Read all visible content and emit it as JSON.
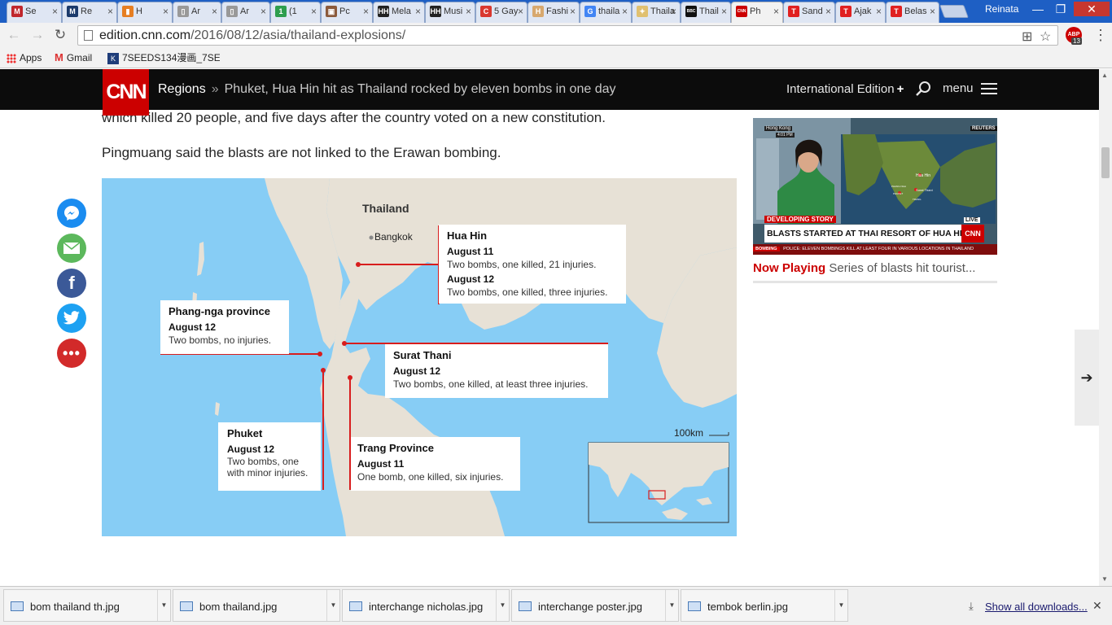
{
  "browser": {
    "tabs": [
      {
        "title": "Se",
        "color": "#c0272d",
        "glyph": "M"
      },
      {
        "title": "Re",
        "color": "#1b3a6b",
        "glyph": "M"
      },
      {
        "title": "H",
        "color": "#e67e22",
        "glyph": "▮"
      },
      {
        "title": "Ar",
        "color": "#999999",
        "glyph": "▯"
      },
      {
        "title": "Ar",
        "color": "#999999",
        "glyph": "▯"
      },
      {
        "title": "(1",
        "color": "#2e9e4e",
        "glyph": "1"
      },
      {
        "title": "Pc",
        "color": "#8b5a3c",
        "glyph": "▣"
      },
      {
        "title": "Mela",
        "color": "#222222",
        "glyph": "HH"
      },
      {
        "title": "Musi",
        "color": "#222222",
        "glyph": "HH"
      },
      {
        "title": "5 Gay",
        "color": "#d9382f",
        "glyph": "C"
      },
      {
        "title": "Fashi",
        "color": "#d7a86e",
        "glyph": "H"
      },
      {
        "title": "thaila",
        "color": "#4285f4",
        "glyph": "G"
      },
      {
        "title": "Thaila",
        "color": "#e0c070",
        "glyph": "✦"
      },
      {
        "title": "Thail",
        "color": "#111111",
        "glyph": "BBC"
      },
      {
        "title": "Ph",
        "color": "#cc0000",
        "glyph": "CNN"
      },
      {
        "title": "Sand",
        "color": "#e02020",
        "glyph": "T"
      },
      {
        "title": "Ajak",
        "color": "#e02020",
        "glyph": "T"
      },
      {
        "title": "Belas",
        "color": "#e02020",
        "glyph": "T"
      }
    ],
    "profile_name": "Reinata",
    "url_host": "edition.cnn.com",
    "url_path": "/2016/08/12/asia/thailand-explosions/",
    "adblock_count": "13",
    "bookmarks": {
      "apps": "Apps",
      "gmail": "Gmail",
      "manga": "7SEEDS134漫画_7SEE"
    }
  },
  "cnn": {
    "logo": "CNN",
    "section": "Regions",
    "separator": "»",
    "headline": "Phuket, Hua Hin hit as Thailand rocked by eleven bombs in one day",
    "edition_label": "International Edition",
    "edition_plus": "+",
    "menu_label": "menu"
  },
  "article": {
    "paragraph_partial": "which killed 20 people, and five days after the country voted on a new constitution.",
    "paragraph": "Pingmuang said the blasts are not linked to the Erawan bombing."
  },
  "share": [
    "messenger",
    "email",
    "facebook",
    "twitter",
    "more"
  ],
  "map": {
    "country_label": "Thailand",
    "capital_label": "Bangkok",
    "scale_label": "100km",
    "callouts": [
      {
        "place": "Hua Hin",
        "entries": [
          {
            "date": "August 11",
            "detail": "Two bombs, one killed, 21 injuries."
          },
          {
            "date": "August 12",
            "detail": "Two bombs, one killed, three injuries."
          }
        ]
      },
      {
        "place": "Phang-nga province",
        "entries": [
          {
            "date": "August 12",
            "detail": "Two bombs, no injuries."
          }
        ]
      },
      {
        "place": "Surat Thani",
        "entries": [
          {
            "date": "August 12",
            "detail": "Two bombs, one killed, at least three injuries."
          }
        ]
      },
      {
        "place": "Phuket",
        "entries": [
          {
            "date": "August 12",
            "detail_lines": [
              "Two bombs, one",
              "with minor injuries."
            ]
          }
        ]
      },
      {
        "place": "Trang Province",
        "entries": [
          {
            "date": "August 11",
            "detail": "One bomb, one killed, six injuries."
          }
        ]
      }
    ],
    "colors": {
      "water": "#87cdf5",
      "land": "#e7e1d6",
      "marker": "#d81d1d"
    }
  },
  "video": {
    "location_tag": "Hong Kong",
    "time_tag": "4:01 PM",
    "agency": "REUTERS",
    "map_labels": {
      "hua_hin": "Hua Hin",
      "surat_thani": "Surat Thani",
      "phang_nga": "PHANG NGA",
      "phuket": "PHUKET",
      "trang": "TRANG"
    },
    "banner_small": "DEVELOPING STORY",
    "banner_main": "BLASTS STARTED AT THAI RESORT OF HUA HIN",
    "live": "LIVE",
    "network": "CNN",
    "ticker_tag": "BOMBING",
    "ticker": "POLICE: ELEVEN BOMBINGS KILL AT LEAST FOUR IN VARIOUS LOCATIONS IN THAILAND",
    "now_label": "Now Playing",
    "now_title": "Series of blasts hit tourist..."
  },
  "downloads": {
    "items": [
      "bom thailand th.jpg",
      "bom thailand.jpg",
      "interchange nicholas.jpg",
      "interchange poster.jpg",
      "tembok berlin.jpg"
    ],
    "show_all": "Show all downloads..."
  }
}
